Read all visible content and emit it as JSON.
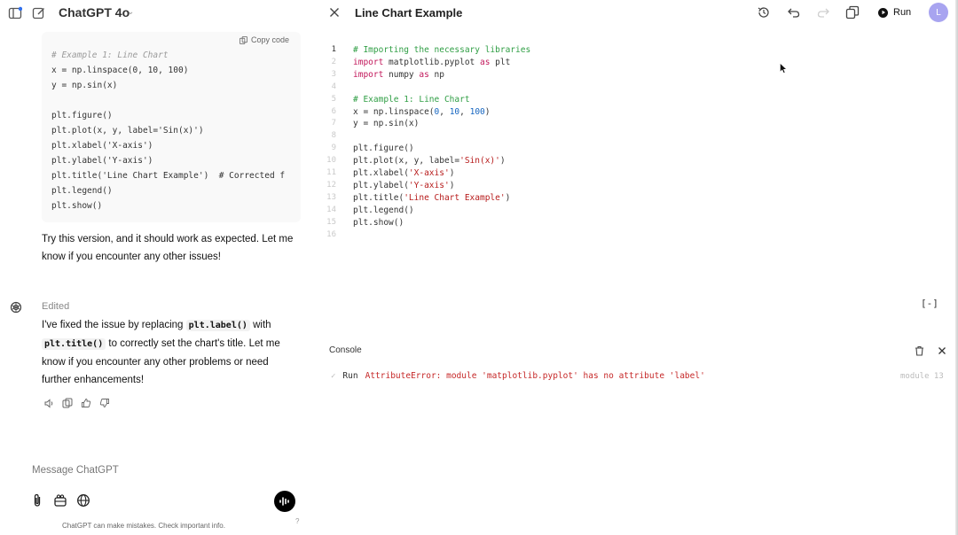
{
  "left": {
    "model_title": "ChatGPT 4o",
    "copy_code_label": "Copy code",
    "code_lines": [
      {
        "text": "# Example 1: Line Chart",
        "kind": "comment"
      },
      {
        "text": "x = np.linspace(0, 10, 100)",
        "kind": "code"
      },
      {
        "text": "y = np.sin(x)",
        "kind": "code"
      },
      {
        "text": "",
        "kind": "code"
      },
      {
        "text": "plt.figure()",
        "kind": "code"
      },
      {
        "text": "plt.plot(x, y, label='Sin(x)')",
        "kind": "code"
      },
      {
        "text": "plt.xlabel('X-axis')",
        "kind": "code"
      },
      {
        "text": "plt.ylabel('Y-axis')",
        "kind": "code"
      },
      {
        "text": "plt.title('Line Chart Example')  # Corrected f",
        "kind": "code"
      },
      {
        "text": "plt.legend()",
        "kind": "code"
      },
      {
        "text": "plt.show()",
        "kind": "code"
      }
    ],
    "message1_line1": "Try this version, and it should work as expected. Let me",
    "message1_line2": "know if you encounter any other issues!",
    "edited_label": "Edited",
    "message2": {
      "p1": "I've fixed the issue by replacing ",
      "code1": "plt.label()",
      "p2": " with",
      "code2": "plt.title()",
      "p3": " to correctly set the chart's title. Let me",
      "line3": "know if you encounter any other problems or need",
      "line4": "further enhancements!"
    },
    "composer_placeholder": "Message ChatGPT",
    "disclaimer": "ChatGPT can make mistakes. Check important info.",
    "help": "?"
  },
  "canvas": {
    "title": "Line Chart Example",
    "run_label": "Run",
    "avatar_initial": "L",
    "collapse_label": "[-]",
    "editor_lines": [
      {
        "n": "1",
        "text": "# Importing the necessary libraries"
      },
      {
        "n": "2",
        "text": "import matplotlib.pyplot as plt"
      },
      {
        "n": "3",
        "text": "import numpy as np"
      },
      {
        "n": "4",
        "text": ""
      },
      {
        "n": "5",
        "text": "# Example 1: Line Chart"
      },
      {
        "n": "6",
        "text": "x = np.linspace(0, 10, 100)"
      },
      {
        "n": "7",
        "text": "y = np.sin(x)"
      },
      {
        "n": "8",
        "text": ""
      },
      {
        "n": "9",
        "text": "plt.figure()"
      },
      {
        "n": "10",
        "text": "plt.plot(x, y, label='Sin(x)')"
      },
      {
        "n": "11",
        "text": "plt.xlabel('X-axis')"
      },
      {
        "n": "12",
        "text": "plt.ylabel('Y-axis')"
      },
      {
        "n": "13",
        "text": "plt.title('Line Chart Example')"
      },
      {
        "n": "14",
        "text": "plt.legend()"
      },
      {
        "n": "15",
        "text": "plt.show()"
      },
      {
        "n": "16",
        "text": ""
      }
    ],
    "console": {
      "title": "Console",
      "check": "✓",
      "run": "Run",
      "error": "AttributeError: module 'matplotlib.pyplot' has no attribute 'label'",
      "module_ref": "module 13"
    }
  },
  "icons": {
    "sidebar": "sidebar-toggle-icon",
    "new_chat": "new-chat-icon",
    "history": "history-icon",
    "undo": "undo-icon",
    "redo": "redo-icon",
    "copy": "copy-icon",
    "close": "close-icon",
    "trash": "trash-icon"
  },
  "colors": {
    "accent_avatar": "#a8a4f0",
    "error": "#c62828",
    "comment": "#2f9e44",
    "keyword": "#c2185b",
    "notification_dot": "#2f6fed"
  }
}
